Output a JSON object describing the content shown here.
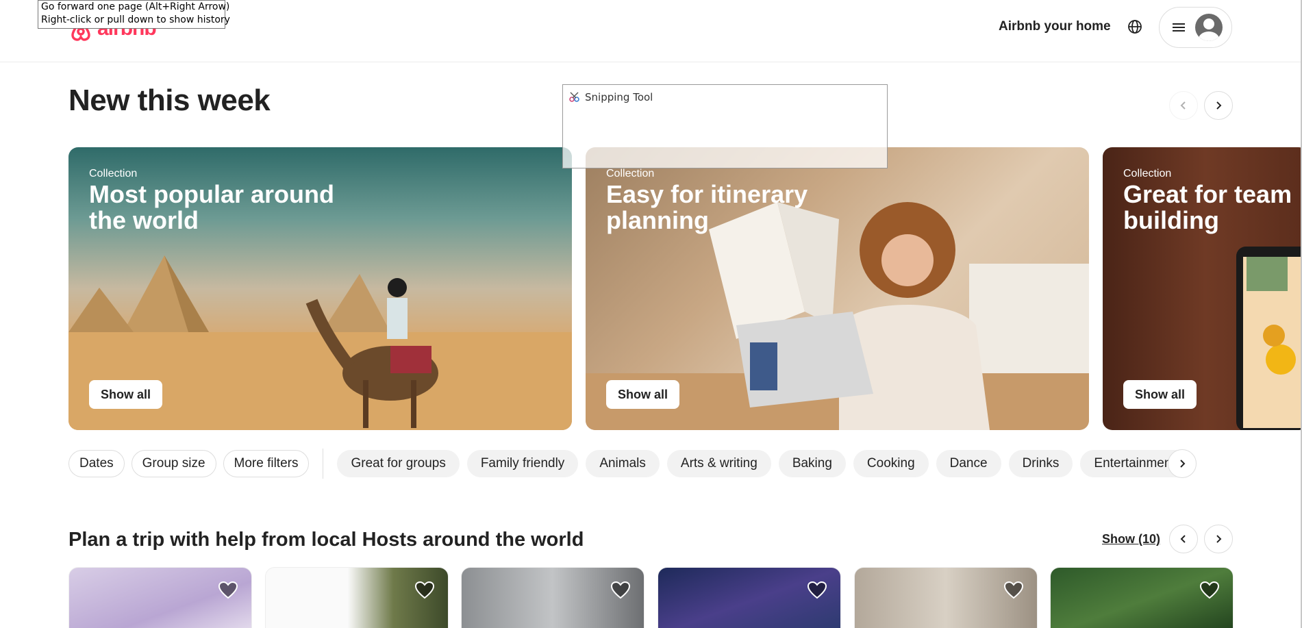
{
  "tooltip": {
    "line1": "Go forward one page (Alt+Right Arrow)",
    "line2": "Right-click or pull down to show history"
  },
  "header": {
    "logo_text": "airbnb",
    "host_link": "Airbnb your home",
    "icons": [
      "airbnb-logo-icon",
      "globe-icon",
      "hamburger-menu-icon",
      "user-avatar-icon"
    ]
  },
  "new_this_week": {
    "title": "New this week"
  },
  "snipping_tool": {
    "title": "Snipping Tool"
  },
  "collections": [
    {
      "kicker": "Collection",
      "title": "Most popular around the world",
      "button": "Show all"
    },
    {
      "kicker": "Collection",
      "title": "Easy for itinerary planning",
      "button": "Show all"
    },
    {
      "kicker": "Collection",
      "title": "Great for team building",
      "button": "Show all"
    }
  ],
  "filters": {
    "main": [
      "Dates",
      "Group size",
      "More filters"
    ],
    "categories": [
      "Great for groups",
      "Family friendly",
      "Animals",
      "Arts & writing",
      "Baking",
      "Cooking",
      "Dance",
      "Drinks",
      "Entertainment"
    ]
  },
  "plan": {
    "title": "Plan a trip with help from local Hosts around the world",
    "show_count": "Show (10)"
  },
  "colors": {
    "brand": "#ff385c",
    "text": "#222222",
    "chip_bg": "#f2f2f2",
    "border": "#dddddd"
  }
}
